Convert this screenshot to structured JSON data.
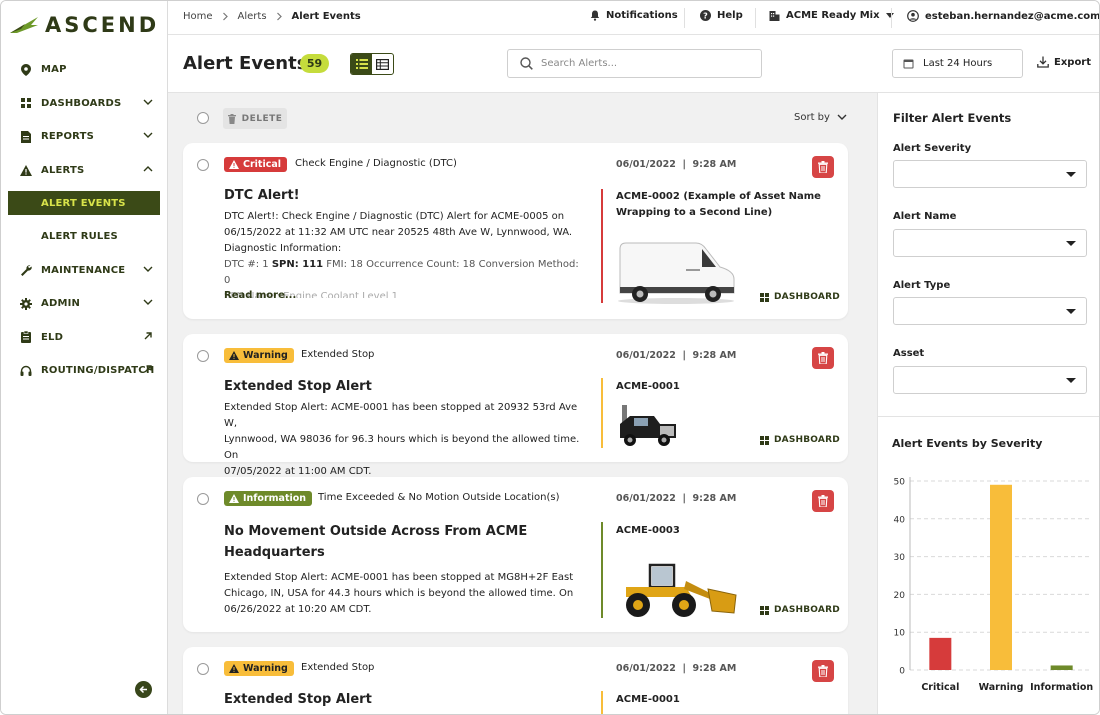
{
  "app": {
    "brand": "ASCEND",
    "accent": "#3b4a17",
    "highlight": "#d8e34a"
  },
  "sidebar": {
    "items": [
      {
        "label": "MAP",
        "icon": "map-pin-icon"
      },
      {
        "label": "DASHBOARDS",
        "icon": "dashboard-grid-icon",
        "expand": "down"
      },
      {
        "label": "REPORTS",
        "icon": "report-document-icon",
        "expand": "down"
      },
      {
        "label": "ALERTS",
        "icon": "alert-triangle-icon",
        "expand": "up"
      },
      {
        "label": "ALERT EVENTS",
        "sub": true,
        "active": true
      },
      {
        "label": "ALERT RULES",
        "sub": true
      },
      {
        "label": "MAINTENANCE",
        "icon": "wrench-icon",
        "expand": "down"
      },
      {
        "label": "ADMIN",
        "icon": "gear-icon",
        "expand": "down"
      },
      {
        "label": "ELD",
        "icon": "clipboard-icon",
        "external": true
      },
      {
        "label": "ROUTING/DISPATCH",
        "icon": "headset-icon",
        "external": true
      }
    ]
  },
  "topbar": {
    "breadcrumb": [
      "Home",
      "Alerts",
      "Alert Events"
    ],
    "notifications": "Notifications",
    "help": "Help",
    "company": "ACME Ready Mix",
    "user": "esteban.hernandez@acme.com"
  },
  "header": {
    "title": "Alert Events",
    "count": "59",
    "search_placeholder": "Search Alerts...",
    "date_range": "Last 24 Hours",
    "export": "Export"
  },
  "list": {
    "delete_label": "DELETE",
    "sort_label": "Sort by",
    "dashboard_label": "DASHBOARD",
    "cards": [
      {
        "severity": "Critical",
        "alert_name": "Check Engine / Diagnostic (DTC)",
        "date": "06/01/2022",
        "time": "9:28 AM",
        "title": "DTC Alert!",
        "body_lines": [
          "DTC Alert!: Check Engine / Diagnostic (DTC) Alert for ACME-0005 on",
          "06/15/2022 at 11:32 AM UTC near 20525 48th Ave W, Lynnwood, WA.",
          "Diagnostic Information:"
        ],
        "dtc_prefix": "DTC #: 1 ",
        "spn_label": "SPN: 111",
        "dtc_rest": " FMI: 18 Occurrence Count: 18 Conversion Method: 0",
        "faded_line": "SPN Name: Engine Coolant Level 1",
        "read_more": "Read more...",
        "asset": "ACME-0002 (Example of Asset Name Wrapping to a Second Line)"
      },
      {
        "severity": "Warning",
        "alert_name": "Extended Stop",
        "date": "06/01/2022",
        "time": "9:28 AM",
        "title": "Extended Stop Alert",
        "body_lines": [
          "Extended Stop Alert: ACME-0001 has been stopped at 20932 53rd Ave W,",
          "Lynnwood, WA 98036 for 96.3 hours which is beyond the allowed time. On",
          "07/05/2022 at 11:00 AM CDT."
        ],
        "asset": "ACME-0001"
      },
      {
        "severity": "Information",
        "alert_name": "Time Exceeded & No Motion Outside Location(s)",
        "date": "06/01/2022",
        "time": "9:28 AM",
        "title": "No Movement Outside Across From ACME Headquarters",
        "body_lines": [
          "Extended Stop Alert: ACME-0001 has been stopped at MG8H+2F East",
          "Chicago, IN, USA for 44.3 hours which is beyond the allowed time. On",
          "06/26/2022 at 10:20 AM CDT."
        ],
        "asset": "ACME-0003"
      },
      {
        "severity": "Warning",
        "alert_name": "Extended Stop",
        "date": "06/01/2022",
        "time": "9:28 AM",
        "title": "Extended Stop Alert",
        "asset": "ACME-0001"
      }
    ]
  },
  "filters": {
    "title": "Filter Alert Events",
    "fields": [
      "Alert Severity",
      "Alert Name",
      "Alert Type",
      "Asset"
    ]
  },
  "chart_title": "Alert Events by Severity",
  "chart_data": {
    "type": "bar",
    "categories": [
      "Critical",
      "Warning",
      "Information"
    ],
    "values": [
      8.5,
      49,
      1.2
    ],
    "colors": [
      "#d63b3b",
      "#f8bd3a",
      "#6e8a2a"
    ],
    "ylim": [
      0,
      50
    ],
    "yticks": [
      0,
      10,
      20,
      30,
      40,
      50
    ],
    "grid": true
  }
}
